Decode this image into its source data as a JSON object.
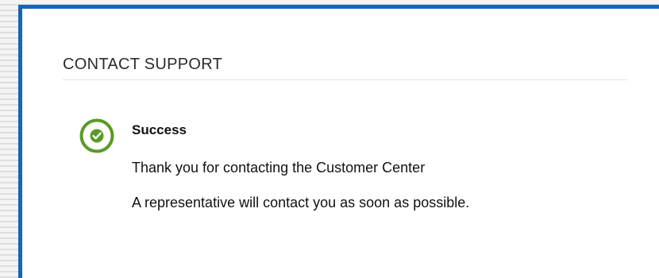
{
  "dialog": {
    "title": "CONTACT SUPPORT",
    "status_icon": "check-circle-icon",
    "accent_color": "#1565b6",
    "success_color": "#5a9a26",
    "message": {
      "heading": "Success",
      "line1": "Thank you for contacting the Customer Center",
      "line2": "A representative will contact you as soon as possible."
    }
  }
}
